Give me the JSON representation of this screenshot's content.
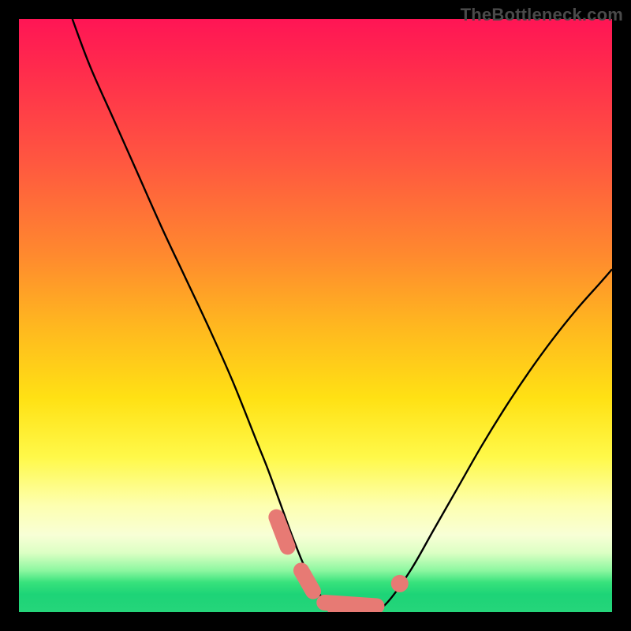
{
  "watermark": "TheBottleneck.com",
  "colors": {
    "frame": "#000000",
    "curve_stroke": "#000000",
    "marker": "#e77a74",
    "gradient_top": "#ff1555",
    "gradient_bottom": "#25d57a"
  },
  "chart_data": {
    "type": "line",
    "title": "",
    "xlabel": "",
    "ylabel": "",
    "xlim": [
      0,
      100
    ],
    "ylim": [
      0,
      100
    ],
    "annotations": [
      "TheBottleneck.com"
    ],
    "series": [
      {
        "name": "bottleneck-curve",
        "comment": "Two branches forming a V; y is bottleneck percentage (0 at flat valley). Values estimated from pixel positions on a 0–100 grid.",
        "x": [
          9,
          12,
          16,
          20,
          24,
          28,
          32,
          36,
          40,
          42,
          44,
          46,
          48,
          50,
          52,
          54,
          56,
          58,
          60,
          62,
          66,
          70,
          74,
          78,
          82,
          86,
          90,
          94,
          98,
          100
        ],
        "y": [
          100,
          92,
          83,
          74,
          65,
          56.5,
          48,
          39,
          29,
          24,
          18.5,
          13,
          8,
          4,
          1.5,
          0.5,
          0.3,
          0.3,
          0.5,
          1.5,
          7,
          14,
          21,
          28,
          34.5,
          40.5,
          46,
          51,
          55.5,
          57.8
        ]
      }
    ],
    "markers": {
      "comment": "Salmon rounded segments near valley, along the curve",
      "points": [
        {
          "x": 43.4,
          "y": 16.0
        },
        {
          "x": 45.3,
          "y": 11.0
        },
        {
          "x": 47.6,
          "y": 7.0
        },
        {
          "x": 49.6,
          "y": 3.5
        },
        {
          "x": 51.5,
          "y": 1.6
        },
        {
          "x": 53.2,
          "y": 0.8
        },
        {
          "x": 55.0,
          "y": 0.4
        },
        {
          "x": 56.8,
          "y": 0.4
        },
        {
          "x": 58.6,
          "y": 0.6
        },
        {
          "x": 60.3,
          "y": 1.0
        },
        {
          "x": 64.2,
          "y": 4.8
        }
      ]
    }
  }
}
